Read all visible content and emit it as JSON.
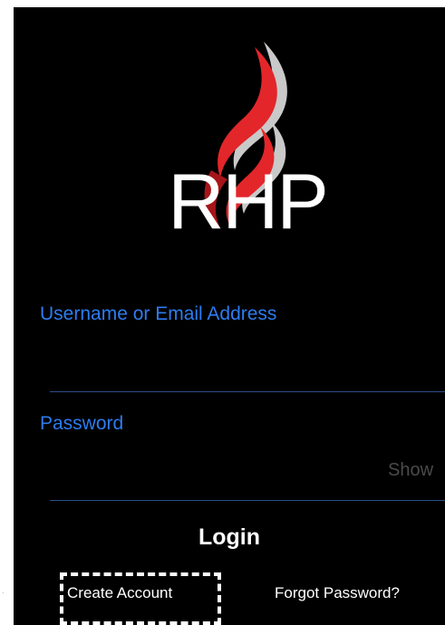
{
  "logo": {
    "text": "RHP",
    "icon": "flame-logo-icon",
    "colors": {
      "flame_red": "#e3262a",
      "flame_dark": "#a51519",
      "flame_silver": "#c9c9c9"
    }
  },
  "form": {
    "username": {
      "label": "Username or Email Address",
      "value": "",
      "placeholder": ""
    },
    "password": {
      "label": "Password",
      "value": "",
      "placeholder": "",
      "show_label": "Show"
    }
  },
  "actions": {
    "login_label": "Login",
    "create_account_label": "Create Account",
    "forgot_password_label": "Forgot Password?"
  },
  "colors": {
    "background": "#000000",
    "label_blue": "#2d7cf0",
    "underline": "#2b4f8a",
    "muted_text": "#4a4a4a",
    "highlight": "#ffffff"
  }
}
